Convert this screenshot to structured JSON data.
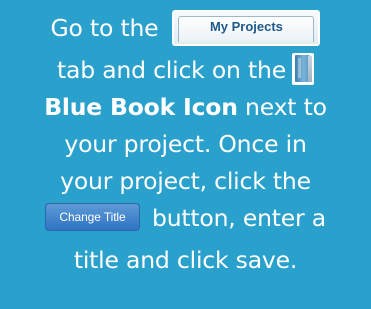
{
  "instructions": {
    "line1_text": "Go to the",
    "my_projects_tab_label": "My Projects",
    "line2_text": "tab and click on the",
    "line3_bold": "Blue Book Icon",
    "line3_rest": " next to",
    "line4_text": "your project. Once in",
    "line5_text": "your project, click the",
    "change_title_button_label": "Change Title",
    "line6_rest": "button, enter a",
    "line7_text": "title and click save."
  },
  "icons": {
    "book": "blue-book-icon"
  },
  "colors": {
    "background": "#2aa1cc",
    "text": "#ffffff",
    "tab_label": "#1f5a8a",
    "change_title_button": "#3a7fcb"
  }
}
